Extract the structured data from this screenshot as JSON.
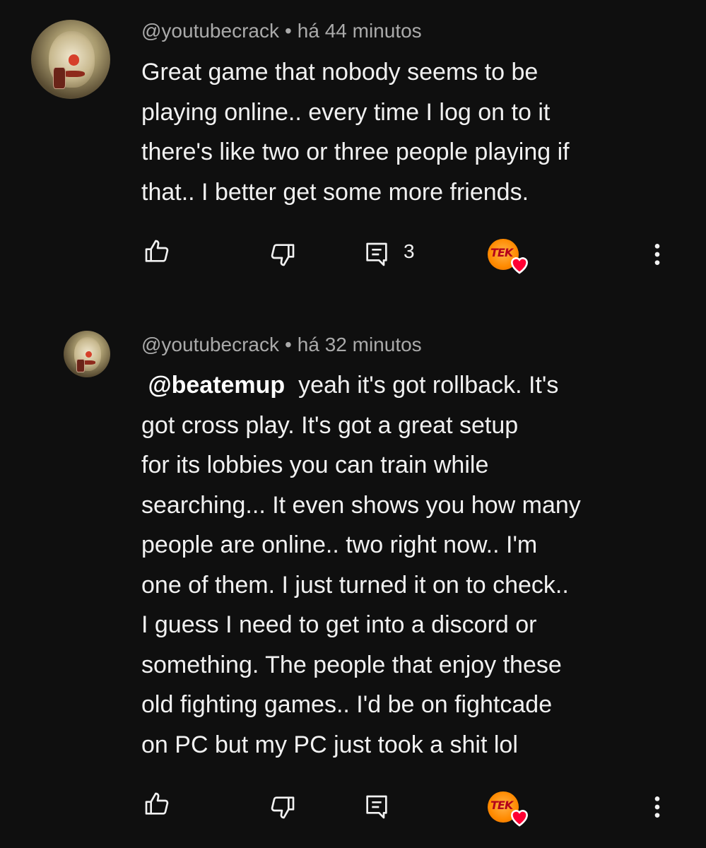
{
  "comments": [
    {
      "author": "@youtubecrack",
      "separator": "•",
      "time": "há 44 minutos",
      "lines": [
        "Great game that nobody seems to be",
        "playing online.. every time I log on to it",
        "there's like two or three people playing if",
        "that.. I better get some more friends."
      ],
      "reply_count": "3",
      "actions": [
        "like-icon",
        "dislike-icon",
        "reply-icon",
        "creator-heart",
        "more-icon"
      ]
    },
    {
      "author": "@youtubecrack",
      "separator": "•",
      "time": "há 32 minutos",
      "mention": "@beatemup",
      "first_line_rest": "yeah it's got rollback. It's",
      "lines": [
        "got cross play. It's got a great setup",
        "for its lobbies you can train while",
        "searching... It even shows you how many",
        "people are online.. two right now.. I'm",
        "one of them. I just turned it on to check..",
        "I guess I need to get into a discord or",
        "something. The people that enjoy these",
        "old fighting games.. I'd be on fightcade",
        "on PC but my PC just took a shit lol"
      ],
      "actions": [
        "like-icon",
        "dislike-icon",
        "reply-icon",
        "creator-heart",
        "more-icon"
      ]
    }
  ],
  "creator_avatar_text": "TEK",
  "colors": {
    "background": "#0f0f0f",
    "text": "#f1f1f1",
    "meta": "#aaaaaa",
    "heart": "#ff0033",
    "creator_avatar": "#ff8a00"
  }
}
